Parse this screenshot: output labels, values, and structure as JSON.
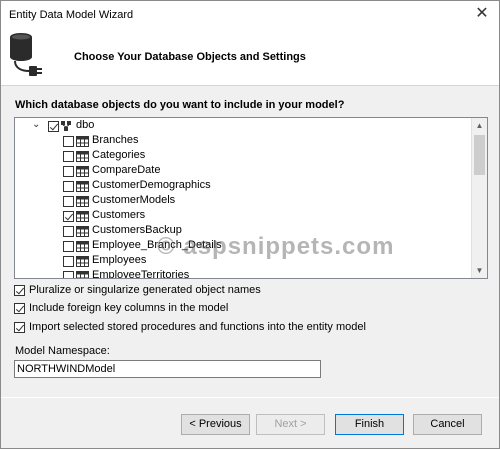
{
  "window": {
    "title": "Entity Data Model Wizard",
    "close_glyph": "✕"
  },
  "header": {
    "title": "Choose Your Database Objects and Settings",
    "icon": "database-connect-icon"
  },
  "question": "Which database objects do you want to include in your model?",
  "tree": {
    "expand_glyph": "⌄",
    "root": {
      "label": "dbo",
      "checked": true
    },
    "items": [
      {
        "label": "Branches",
        "checked": false
      },
      {
        "label": "Categories",
        "checked": false
      },
      {
        "label": "CompareDate",
        "checked": false
      },
      {
        "label": "CustomerDemographics",
        "checked": false
      },
      {
        "label": "CustomerModels",
        "checked": false
      },
      {
        "label": "Customers",
        "checked": true
      },
      {
        "label": "CustomersBackup",
        "checked": false
      },
      {
        "label": "Employee_Branch_Details",
        "checked": false
      },
      {
        "label": "Employees",
        "checked": false
      },
      {
        "label": "EmployeeTerritories",
        "checked": false
      }
    ]
  },
  "options": [
    {
      "label": "Pluralize or singularize generated object names",
      "checked": true
    },
    {
      "label": "Include foreign key columns in the model",
      "checked": true
    },
    {
      "label": "Import selected stored procedures and functions into the entity model",
      "checked": true
    }
  ],
  "namespace": {
    "label": "Model Namespace:",
    "value": "NORTHWINDModel"
  },
  "buttons": {
    "previous": "< Previous",
    "next": "Next >",
    "finish": "Finish",
    "cancel": "Cancel"
  },
  "watermark": "© aspsnippets.com",
  "colors": {
    "focus_border": "#0078d7",
    "window_bg": "#f0f0f0"
  }
}
